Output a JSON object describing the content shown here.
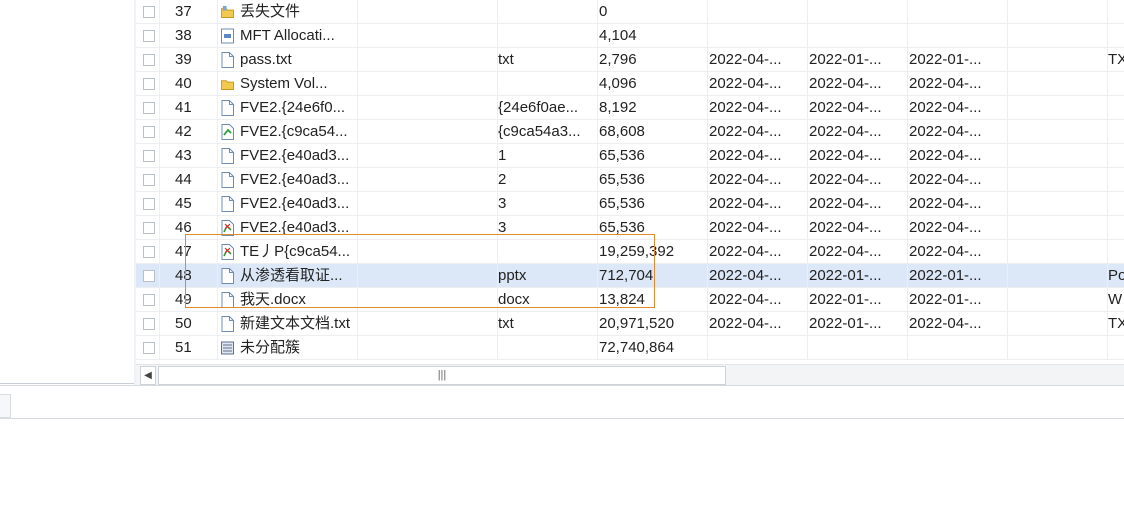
{
  "table": {
    "rows": [
      {
        "num": "37",
        "icon": "folder-warning-icon",
        "name": "丢失文件",
        "ext": "",
        "size": "0",
        "d1": "",
        "d2": "",
        "d3": "",
        "cat": ""
      },
      {
        "num": "38",
        "icon": "system-file-icon",
        "name": "MFT Allocati...",
        "ext": "",
        "size": "4,104",
        "d1": "",
        "d2": "",
        "d3": "",
        "cat": ""
      },
      {
        "num": "39",
        "icon": "document-icon",
        "name": "pass.txt",
        "ext": "txt",
        "size": "2,796",
        "d1": "2022-04-...",
        "d2": "2022-01-...",
        "d3": "2022-01-...",
        "cat": "TX"
      },
      {
        "num": "40",
        "icon": "folder-icon",
        "name": "System Vol...",
        "ext": "",
        "size": "4,096",
        "d1": "2022-04-...",
        "d2": "2022-04-...",
        "d3": "2022-04-...",
        "cat": ""
      },
      {
        "num": "41",
        "icon": "document-icon",
        "name": "FVE2.{24e6f0...",
        "ext": "{24e6f0ae...",
        "size": "8,192",
        "d1": "2022-04-...",
        "d2": "2022-04-...",
        "d3": "2022-04-...",
        "cat": ""
      },
      {
        "num": "42",
        "icon": "recovered-file-icon",
        "name": "FVE2.{c9ca54...",
        "ext": "{c9ca54a3...",
        "size": "68,608",
        "d1": "2022-04-...",
        "d2": "2022-04-...",
        "d3": "2022-04-...",
        "cat": ""
      },
      {
        "num": "43",
        "icon": "document-icon",
        "name": "FVE2.{e40ad3...",
        "ext": "1",
        "size": "65,536",
        "d1": "2022-04-...",
        "d2": "2022-04-...",
        "d3": "2022-04-...",
        "cat": ""
      },
      {
        "num": "44",
        "icon": "document-icon",
        "name": "FVE2.{e40ad3...",
        "ext": "2",
        "size": "65,536",
        "d1": "2022-04-...",
        "d2": "2022-04-...",
        "d3": "2022-04-...",
        "cat": ""
      },
      {
        "num": "45",
        "icon": "document-icon",
        "name": "FVE2.{e40ad3...",
        "ext": "3",
        "size": "65,536",
        "d1": "2022-04-...",
        "d2": "2022-04-...",
        "d3": "2022-04-...",
        "cat": ""
      },
      {
        "num": "46",
        "icon": "deleted-file-icon",
        "name": "FVE2.{e40ad3...",
        "ext": "3",
        "size": "65,536",
        "d1": "2022-04-...",
        "d2": "2022-04-...",
        "d3": "2022-04-...",
        "cat": ""
      },
      {
        "num": "47",
        "icon": "deleted-file-icon",
        "name": "TE丿P{c9ca54...",
        "ext": "",
        "size": "19,259,392",
        "d1": "2022-04-...",
        "d2": "2022-04-...",
        "d3": "2022-04-...",
        "cat": ""
      },
      {
        "num": "48",
        "icon": "document-icon",
        "name": "从渗透看取证...",
        "ext": "pptx",
        "size": "712,704",
        "d1": "2022-04-...",
        "d2": "2022-01-...",
        "d3": "2022-01-...",
        "cat": "Po",
        "selected": true
      },
      {
        "num": "49",
        "icon": "document-icon",
        "name": "我天.docx",
        "ext": "docx",
        "size": "13,824",
        "d1": "2022-04-...",
        "d2": "2022-01-...",
        "d3": "2022-01-...",
        "cat": "W"
      },
      {
        "num": "50",
        "icon": "document-icon",
        "name": "新建文本文档.txt",
        "ext": "txt",
        "size": "20,971,520",
        "d1": "2022-04-...",
        "d2": "2022-01-...",
        "d3": "2022-04-...",
        "cat": "TX"
      },
      {
        "num": "51",
        "icon": "unallocated-icon",
        "name": "未分配簇",
        "ext": "",
        "size": "72,740,864",
        "d1": "",
        "d2": "",
        "d3": "",
        "cat": ""
      }
    ]
  },
  "scrollbar": {
    "left_arrow": "◀",
    "thumb_grip": "|||"
  },
  "colors": {
    "selected_row": "#dce8f8",
    "highlight_box": "#e08a2e",
    "gridline": "#eceef2"
  }
}
